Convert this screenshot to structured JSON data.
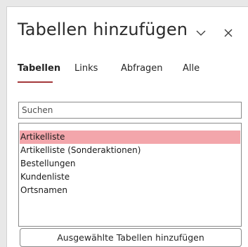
{
  "pane": {
    "title": "Tabellen hinzufügen"
  },
  "controls": {
    "dropdown_icon": "chevron-down-icon",
    "close_icon": "close-icon"
  },
  "tabs": [
    {
      "label": "Tabellen",
      "active": true
    },
    {
      "label": "Links",
      "active": false
    },
    {
      "label": "Abfragen",
      "active": false
    },
    {
      "label": "Alle",
      "active": false
    }
  ],
  "search": {
    "placeholder": "Suchen",
    "value": ""
  },
  "table_list": {
    "items": [
      {
        "label": "Artikelliste",
        "selected": true
      },
      {
        "label": "Artikelliste (Sonderaktionen)",
        "selected": false
      },
      {
        "label": "Bestellungen",
        "selected": false
      },
      {
        "label": "Kundenliste",
        "selected": false
      },
      {
        "label": "Ortsnamen",
        "selected": false
      }
    ]
  },
  "actions": {
    "add_selected_label": "Ausgewählte Tabellen hinzufügen"
  },
  "colors": {
    "accent": "#a4373a",
    "selection": "#f3a6ab"
  }
}
